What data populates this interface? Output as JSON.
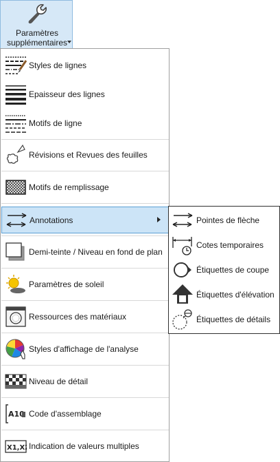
{
  "ribbon_button": {
    "line1": "Paramètres",
    "line2": "supplémentaires",
    "icon": "wrench-icon"
  },
  "menu": {
    "items": [
      {
        "label": "Styles de lignes",
        "icon": "line-styles-icon"
      },
      {
        "label": "Epaisseur des lignes",
        "icon": "line-weights-icon"
      },
      {
        "label": "Motifs de ligne",
        "icon": "line-patterns-icon"
      },
      {
        "label": "Révisions et Revues des feuilles",
        "icon": "revision-cloud-icon"
      },
      {
        "label": "Motifs de remplissage",
        "icon": "fill-patterns-icon"
      },
      {
        "label": "Annotations",
        "icon": "annotations-arrows-icon"
      },
      {
        "label": "Demi-teinte / Niveau en fond de plan",
        "icon": "halftone-icon"
      },
      {
        "label": "Paramètres de soleil",
        "icon": "sun-icon"
      },
      {
        "label": "Ressources des matériaux",
        "icon": "material-assets-icon"
      },
      {
        "label": "Styles d'affichage de l'analyse",
        "icon": "analysis-display-icon"
      },
      {
        "label": "Niveau de détail",
        "icon": "detail-level-icon"
      },
      {
        "label": "Code d'assemblage",
        "icon": "assembly-code-icon"
      },
      {
        "label": "Indication de valeurs multiples",
        "icon": "multiple-values-icon"
      }
    ]
  },
  "submenu": {
    "items": [
      {
        "label": "Pointes de flèche",
        "icon": "arrowheads-icon"
      },
      {
        "label": "Cotes temporaires",
        "icon": "temporary-dimensions-icon"
      },
      {
        "label": "Étiquettes de coupe",
        "icon": "section-tag-icon"
      },
      {
        "label": "Étiquettes d'élévation",
        "icon": "elevation-tag-icon"
      },
      {
        "label": "Étiquettes de détails",
        "icon": "callout-tag-icon"
      }
    ]
  },
  "colors": {
    "highlight_bg": "#cce4f7",
    "highlight_border": "#5a9fd4",
    "ribbon_bg": "#d6e8f7"
  }
}
